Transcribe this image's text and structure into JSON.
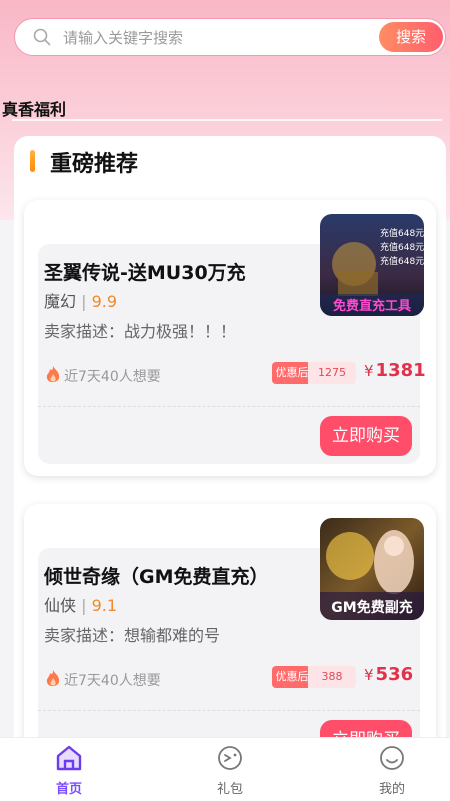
{
  "search": {
    "placeholder": "请输入关键字搜索",
    "button": "搜索"
  },
  "section_label": "真香福利",
  "panel_title": "重磅推荐",
  "games": [
    {
      "title": "圣翼传说-送MU30万充",
      "genre": "魔幻",
      "score": "9.9",
      "desc": "卖家描述：战力极强！！！",
      "want": "近7天40人想要",
      "tag_after": "优惠后",
      "tag_value": "1275",
      "price_symbol": "¥",
      "price": "1381",
      "buy": "立即购买",
      "thumb_text": "免费直充工具",
      "thumb_lines": [
        "充值648元",
        "充值648元",
        "充值648元"
      ]
    },
    {
      "title": "倾世奇缘（GM免费直充）",
      "genre": "仙侠",
      "score": "9.1",
      "desc": "卖家描述：想输都难的号",
      "want": "近7天40人想要",
      "tag_after": "优惠后",
      "tag_value": "388",
      "price_symbol": "¥",
      "price": "536",
      "buy": "立即购买",
      "thumb_text": "GM免费副充"
    }
  ],
  "tabs": [
    {
      "label": "首页",
      "icon": "home-icon",
      "active": true
    },
    {
      "label": "礼包",
      "icon": "gift-icon",
      "active": false
    },
    {
      "label": "我的",
      "icon": "smile-icon",
      "active": false
    }
  ],
  "colors": {
    "accent": "#ff4d6a",
    "tab_active": "#7a4cff",
    "score": "#f08a2a"
  }
}
